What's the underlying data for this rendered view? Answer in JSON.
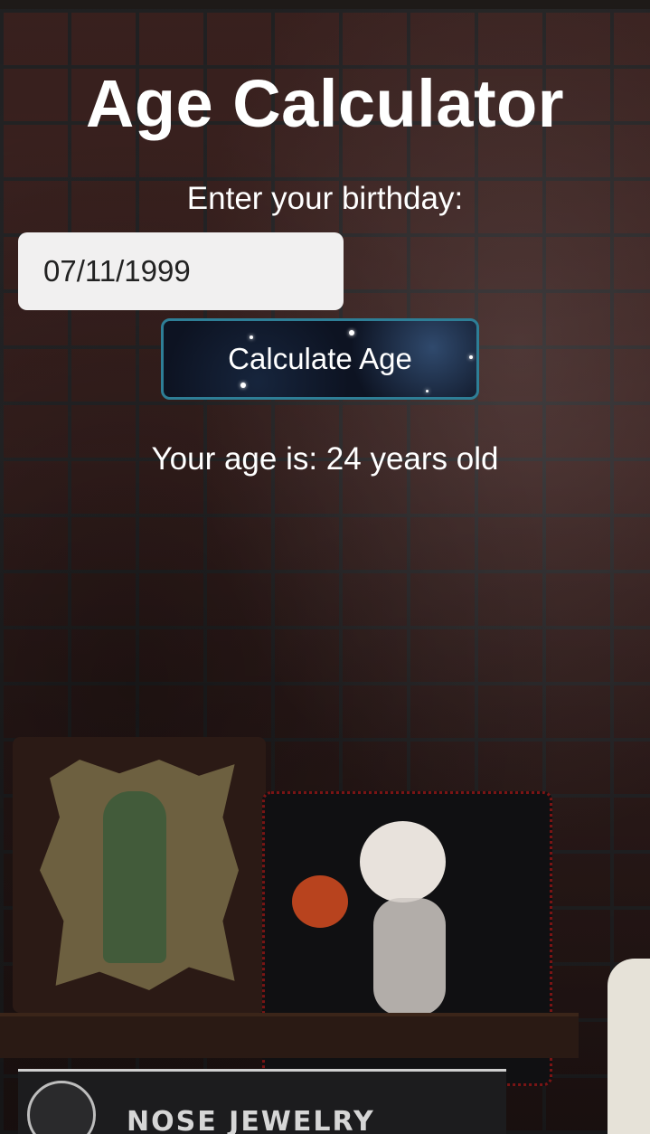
{
  "app": {
    "title": "Age Calculator"
  },
  "form": {
    "prompt": "Enter your birthday:",
    "birthday_value": "07/11/1999",
    "button_label": "Calculate Age"
  },
  "result": {
    "text": "Your age is: 24 years old"
  },
  "background": {
    "sign_text": "NOSE JEWELRY"
  },
  "colors": {
    "text": "#ffffff",
    "input_bg": "#f1f0f0",
    "button_border": "#2e7e96",
    "button_bg": "#0d1322"
  }
}
